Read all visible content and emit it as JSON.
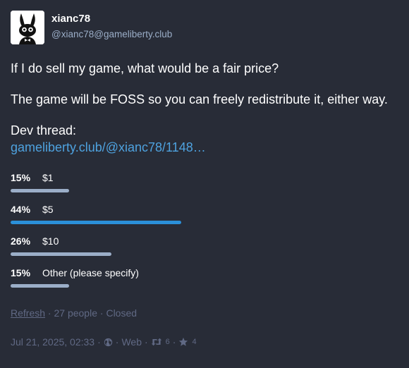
{
  "author": {
    "display_name": "xianc78",
    "handle": "@xianc78@gameliberty.club",
    "avatar_icon": "rabbit-avatar"
  },
  "content": {
    "paragraph_1": "If I do sell my game, what would be a fair price?",
    "paragraph_2": "The game will be FOSS so you can freely redistribute it, either way.",
    "paragraph_3_label": "Dev thread:",
    "link_text": "gameliberty.club/@xianc78/1148…"
  },
  "poll": {
    "options": [
      {
        "percent_label": "15%",
        "label": "$1",
        "fraction": 0.15,
        "leading": false
      },
      {
        "percent_label": "44%",
        "label": "$5",
        "fraction": 0.44,
        "leading": true
      },
      {
        "percent_label": "26%",
        "label": "$10",
        "fraction": 0.26,
        "leading": false
      },
      {
        "percent_label": "15%",
        "label": "Other (please specify)",
        "fraction": 0.15,
        "leading": false
      }
    ],
    "refresh_label": "Refresh",
    "separator": "·",
    "voters": "27 people",
    "status": "Closed"
  },
  "meta": {
    "timestamp": "Jul 21, 2025, 02:33",
    "separator": "·",
    "visibility_icon": "globe-icon",
    "application": "Web",
    "boost_icon": "boost-icon",
    "boosts": "6",
    "favourite_icon": "star-icon",
    "favourites": "4"
  },
  "colors": {
    "background": "#282c37",
    "link": "#4ea2df",
    "bar_leading": "#2b90d9",
    "bar_normal": "#9baec8",
    "muted": "#606984"
  }
}
